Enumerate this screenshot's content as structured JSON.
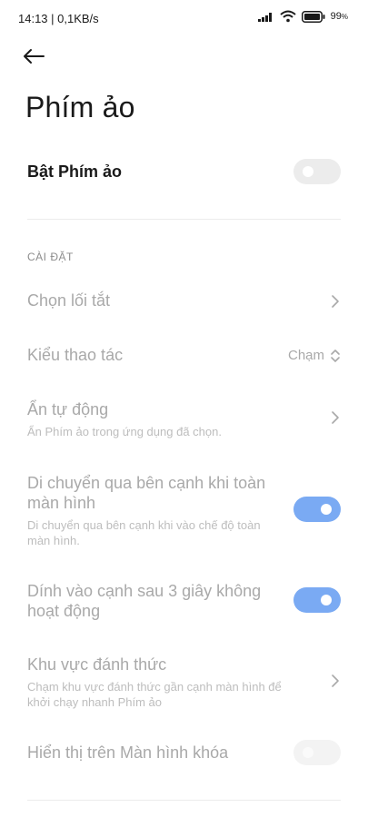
{
  "status_bar": {
    "time_speed": "14:13 | 0,1KB/s",
    "battery": "99",
    "battery_unit": "%"
  },
  "header": {
    "title": "Phím ảo"
  },
  "main_toggle": {
    "label": "Bật Phím ảo",
    "on": false
  },
  "section": {
    "header": "CÀI ĐẶT"
  },
  "items": {
    "shortcut": {
      "title": "Chọn lối tắt"
    },
    "action_type": {
      "title": "Kiểu thao tác",
      "value": "Chạm"
    },
    "auto_hide": {
      "title": "Ẩn tự động",
      "subtitle": "Ẩn Phím ảo trong ứng dụng đã chọn."
    },
    "fullscreen_side": {
      "title_line1": "Di chuyển qua bên cạnh khi toàn",
      "title_line2": "màn hình",
      "subtitle_line1": "Di chuyển qua bên cạnh khi vào chế độ toàn",
      "subtitle_line2": "màn hình.",
      "on": true
    },
    "stick_edge": {
      "title_line1": "Dính vào cạnh sau 3 giây không",
      "title_line2": "hoạt động",
      "on": true
    },
    "wake_area": {
      "title": "Khu vực đánh thức",
      "subtitle_line1": "Chạm khu vực đánh thức gần cạnh màn hình để",
      "subtitle_line2": "khởi chạy nhanh Phím ảo"
    },
    "lock_screen": {
      "title": "Hiển thị trên Màn hình khóa",
      "on": false
    }
  },
  "colors": {
    "accent": "#7aaaf3",
    "disabled_text": "#a9a9a9",
    "section_header": "#8c8c8c"
  }
}
